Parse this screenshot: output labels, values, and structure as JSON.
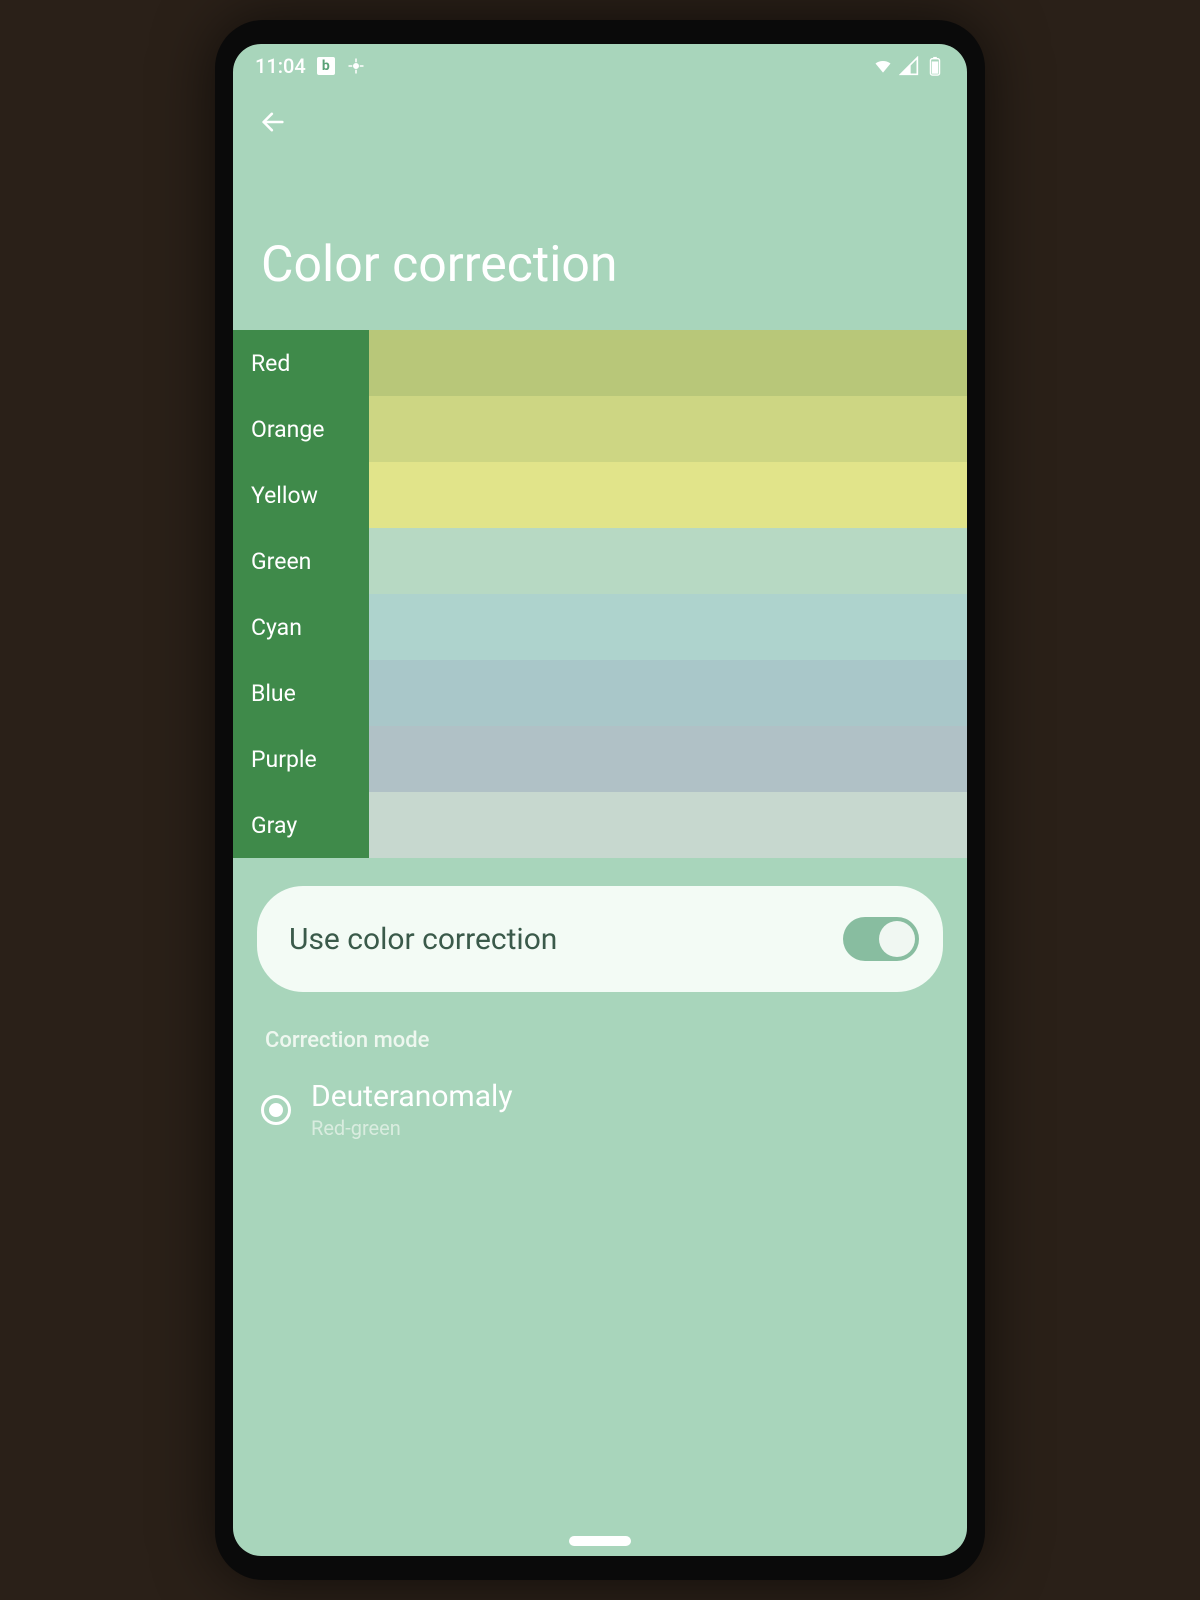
{
  "status": {
    "time": "11:04",
    "left_icons": [
      "b-icon",
      "crosshair-icon"
    ],
    "right_icons": [
      "wifi-icon",
      "signal-icon",
      "battery-icon"
    ]
  },
  "header": {
    "back_label": "Back",
    "title": "Color correction"
  },
  "swatches": [
    {
      "label": "Red",
      "color": "#b8c779"
    },
    {
      "label": "Orange",
      "color": "#cdd683"
    },
    {
      "label": "Yellow",
      "color": "#e1e48a"
    },
    {
      "label": "Green",
      "color": "#b7d9c3"
    },
    {
      "label": "Cyan",
      "color": "#aed3cd"
    },
    {
      "label": "Blue",
      "color": "#a9c7c9"
    },
    {
      "label": "Purple",
      "color": "#b0c1c6"
    },
    {
      "label": "Gray",
      "color": "#c7d8cf"
    }
  ],
  "toggle": {
    "label": "Use color correction",
    "on": true
  },
  "mode_section": {
    "header": "Correction mode",
    "options": [
      {
        "title": "Deuteranomaly",
        "subtitle": "Red-green",
        "selected": true
      }
    ]
  }
}
